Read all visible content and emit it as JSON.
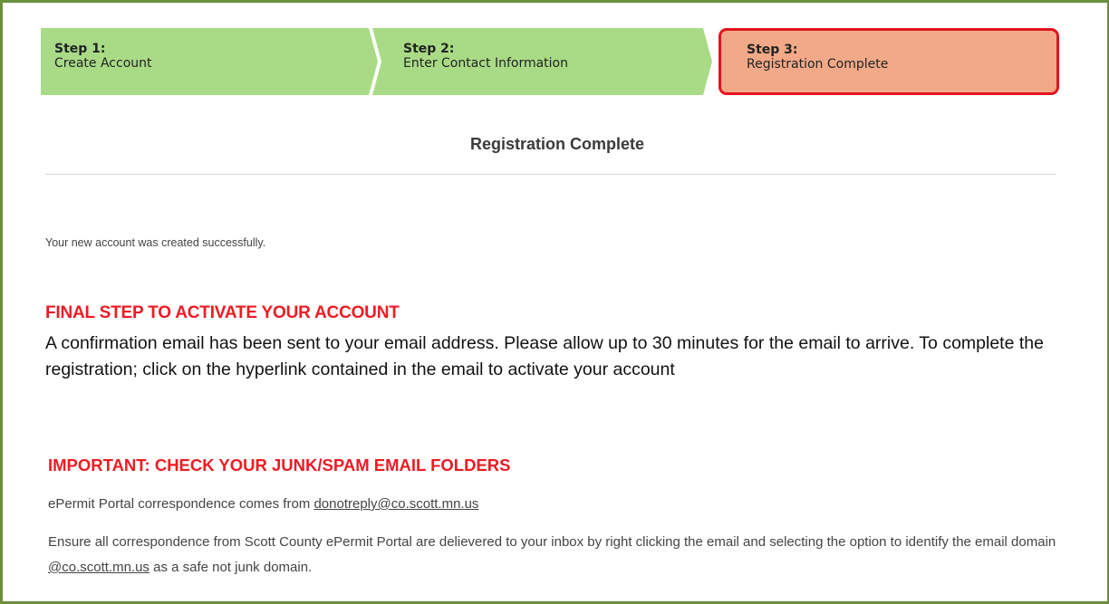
{
  "wizard": {
    "steps": [
      {
        "title": "Step 1:",
        "subtitle": "Create Account"
      },
      {
        "title": "Step 2:",
        "subtitle": "Enter Contact Information"
      },
      {
        "title": "Step 3:",
        "subtitle": "Registration Complete"
      }
    ],
    "active_step": 3,
    "colors": {
      "completed": "#a9db86",
      "active": "#f2a988",
      "active_border": "#e3141e"
    }
  },
  "page": {
    "title": "Registration Complete",
    "success_message": "Your new account was created successfully.",
    "final_step": {
      "heading": "FINAL STEP TO ACTIVATE YOUR ACCOUNT",
      "text": "A confirmation email has been sent to your email address.  Please allow up to 30 minutes for the email to arrive.  To complete the registration; click on the hyperlink contained in the email to activate your account"
    },
    "important": {
      "heading": "IMPORTANT: CHECK YOUR JUNK/SPAM EMAIL FOLDERS",
      "correspondence_prefix": "ePermit Portal correspondence comes from ",
      "sender_email": "donotreply@co.scott.mn.us",
      "ensure_prefix": "Ensure all correspondence from Scott County ePermit Portal are delievered to your inbox by right clicking the email and selecting the option to identify the email domain ",
      "domain": "@co.scott.mn.us",
      "ensure_suffix": " as a safe not junk domain."
    },
    "accent_color": "#ee1b24",
    "frame_color": "#6b8f3a"
  }
}
